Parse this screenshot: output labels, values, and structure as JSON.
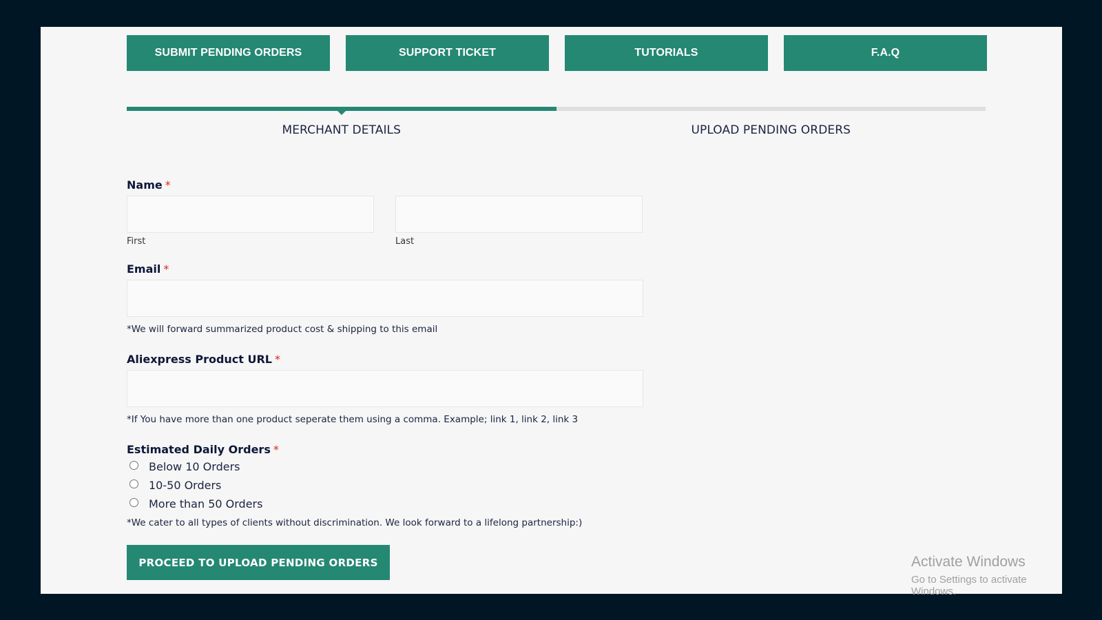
{
  "nav": {
    "buttons": [
      "SUBMIT PENDING ORDERS",
      "SUPPORT TICKET",
      "TUTORIALS",
      "F.A.Q"
    ]
  },
  "progress": {
    "fraction": 0.5,
    "steps": [
      "MERCHANT DETAILS",
      "UPLOAD PENDING ORDERS"
    ],
    "active_step": 0
  },
  "form": {
    "name": {
      "label": "Name",
      "required": "*",
      "first_sub": "First",
      "last_sub": "Last",
      "first_value": "",
      "last_value": ""
    },
    "email": {
      "label": "Email",
      "required": "*",
      "value": "",
      "help": "*We will forward summarized product cost & shipping to this email"
    },
    "url": {
      "label": "Aliexpress Product URL",
      "required": "*",
      "value": "",
      "help": "*If You have more than one product seperate them using a comma. Example; link 1, link 2, link 3"
    },
    "daily": {
      "label": "Estimated Daily Orders",
      "required": "*",
      "options": [
        "Below 10 Orders",
        "10-50 Orders",
        "More than 50 Orders"
      ],
      "help": "*We cater to all types of clients without discrimination. We look forward to a lifelong partnership:)"
    },
    "submit_label": "PROCEED TO UPLOAD PENDING ORDERS"
  },
  "watermark": {
    "title": "Activate Windows",
    "subtitle": "Go to Settings to activate Windows."
  },
  "colors": {
    "accent": "#248873",
    "outer_bg": "#011624",
    "page_bg": "#f6f6f6",
    "required": "#e02424"
  }
}
